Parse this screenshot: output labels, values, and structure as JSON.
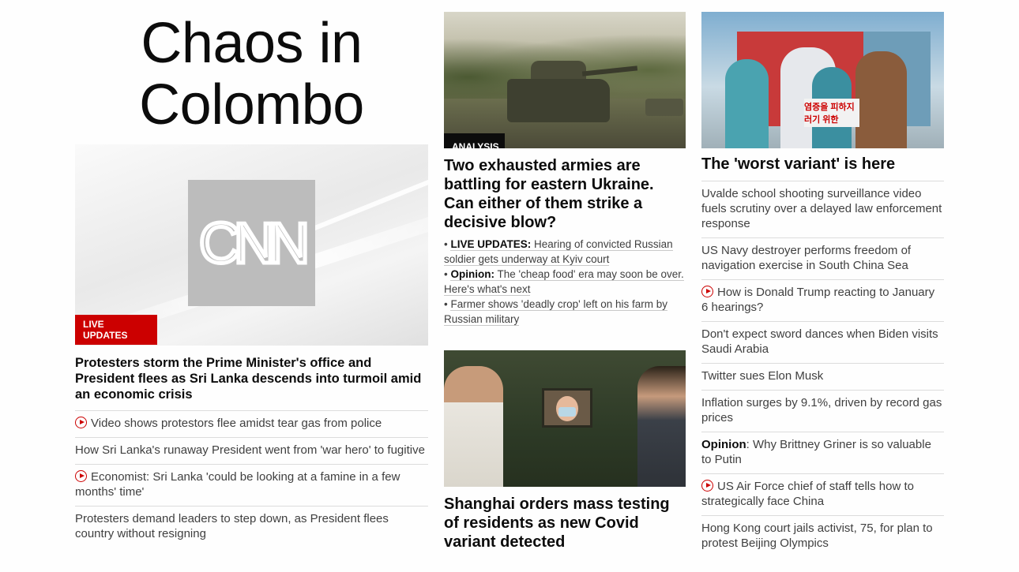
{
  "lead": {
    "banner": "Chaos in Colombo",
    "logo_text": "CNN",
    "badge": "LIVE UPDATES",
    "headline": "Protesters storm the Prime Minister's office and President flees as Sri Lanka descends into turmoil amid an economic crisis",
    "related": [
      {
        "text": "Video shows protestors flee amidst tear gas from police",
        "video": true
      },
      {
        "text": "How Sri Lanka's runaway President went from 'war hero' to fugitive",
        "video": false
      },
      {
        "text": "Economist: Sri Lanka 'could be looking at a famine in a few months' time'",
        "video": true
      },
      {
        "text": "Protesters demand leaders to step down, as President flees country without resigning",
        "video": false
      }
    ]
  },
  "ukraine": {
    "badge": "ANALYSIS",
    "headline": "Two exhausted armies are battling for eastern Ukraine. Can either of them strike a decisive blow?",
    "bullets": [
      {
        "label": "LIVE UPDATES:",
        "text": "Hearing of convicted Russian soldier gets underway at Kyiv court"
      },
      {
        "label": "Opinion:",
        "text": "The 'cheap food' era may soon be over. Here's what's next"
      },
      {
        "label": "",
        "text": "Farmer shows 'deadly crop' left on his farm by Russian military"
      }
    ]
  },
  "shanghai": {
    "headline": "Shanghai orders mass testing of residents as new Covid variant detected"
  },
  "covid": {
    "sign_text": "염증을 피하지\n러기 위한",
    "headline": "The 'worst variant' is here",
    "list": [
      {
        "text": "Uvalde school shooting surveillance video fuels scrutiny over a delayed law enforcement response",
        "video": false,
        "lead": ""
      },
      {
        "text": "US Navy destroyer performs freedom of navigation exercise in South China Sea",
        "video": false,
        "lead": ""
      },
      {
        "text": "How is Donald Trump reacting to January 6 hearings?",
        "video": true,
        "lead": ""
      },
      {
        "text": "Don't expect sword dances when Biden visits Saudi Arabia",
        "video": false,
        "lead": ""
      },
      {
        "text": "Twitter sues Elon Musk",
        "video": false,
        "lead": ""
      },
      {
        "text": "Inflation surges by 9.1%, driven by record gas prices",
        "video": false,
        "lead": ""
      },
      {
        "text": ": Why Brittney Griner is so valuable to Putin",
        "video": false,
        "lead": "Opinion"
      },
      {
        "text": "US Air Force chief of staff tells how to strategically face China",
        "video": true,
        "lead": ""
      },
      {
        "text": "Hong Kong court jails activist, 75, for plan to protest Beijing Olympics",
        "video": false,
        "lead": ""
      }
    ]
  },
  "colors": {
    "live_badge": "#cc0000",
    "analysis_badge": "#0c0c0c",
    "play_icon": "#cc0000"
  }
}
